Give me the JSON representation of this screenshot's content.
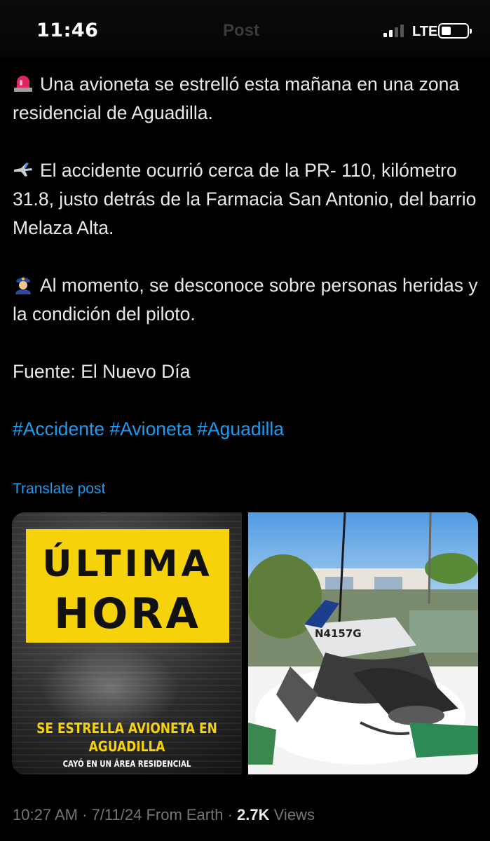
{
  "status_bar": {
    "time": "11:46",
    "header_title": "Post",
    "network": "LTE",
    "signal_bars": 2,
    "battery_level": 0.3
  },
  "post": {
    "paragraphs": [
      {
        "emoji": "rotating-light-icon",
        "text": "Una avioneta se estrelló esta mañana en una zona residencial de Aguadilla."
      },
      {
        "emoji": "airplane-icon",
        "text": "El accidente ocurrió cerca de la PR- 110, kilómetro 31.8, justo detrás de la Farmacia San Antonio, del barrio Melaza Alta."
      },
      {
        "emoji": "police-officer-icon",
        "text": "Al momento, se desconoce sobre personas heridas y la condición del piloto."
      },
      {
        "emoji": null,
        "text": "Fuente: El Nuevo Día"
      }
    ],
    "hashtags": [
      "#Accidente",
      "#Avioneta",
      "#Aguadilla"
    ],
    "translate_label": "Translate post",
    "media": {
      "left_card": {
        "banner_line1": "ÚLTIMA",
        "banner_line2": "HORA",
        "headline_line1": "SE ESTRELLA AVIONETA EN",
        "headline_line2": "AGUADILLA",
        "subheadline": "CAYÓ EN UN ÁREA RESIDENCIAL"
      },
      "right_photo": {
        "tail_number": "N4157G"
      }
    },
    "meta": {
      "time": "10:27 AM",
      "date": "7/11/24",
      "source": "From Earth",
      "views_count": "2.7K",
      "views_label": "Views",
      "separator": "·"
    }
  },
  "colors": {
    "background": "#000000",
    "text": "#e7e9ea",
    "link": "#1d9bf0",
    "muted": "#71767b",
    "banner_yellow": "#f5d20a"
  }
}
